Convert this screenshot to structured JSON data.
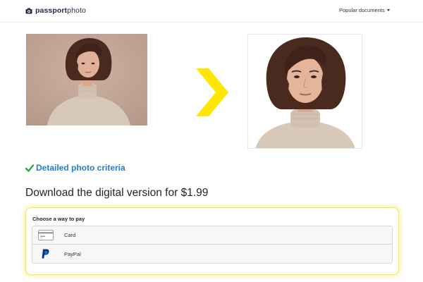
{
  "header": {
    "logo_strong": "passport",
    "logo_light": "photo",
    "nav_popular": "Popular documents"
  },
  "criteria": {
    "label": "Detailed photo criteria"
  },
  "download": {
    "heading": "Download the digital version for $1.99"
  },
  "payment": {
    "title": "Choose a way to pay",
    "options": [
      {
        "label": "Card",
        "icon": "credit-card-icon"
      },
      {
        "label": "PayPal",
        "icon": "paypal-icon"
      }
    ]
  },
  "colors": {
    "accent_yellow": "#ffe600",
    "link_blue": "#1f7ed0",
    "check_green": "#2ea44f",
    "paypal_blue": "#003087"
  }
}
